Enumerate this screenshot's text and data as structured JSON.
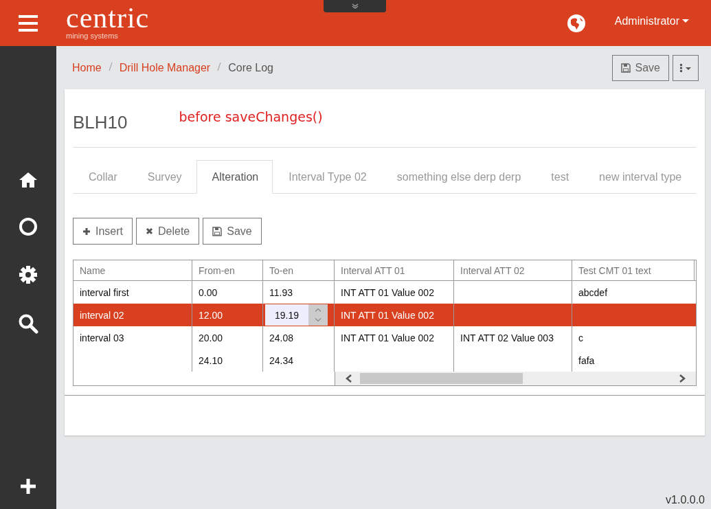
{
  "header": {
    "logo": "centric",
    "logo_tagline": "mining systems",
    "user": "Administrator"
  },
  "breadcrumb": [
    {
      "label": "Home",
      "link": true
    },
    {
      "label": "Drill Hole Manager",
      "link": true
    },
    {
      "label": "Core Log",
      "link": false
    }
  ],
  "page_actions": {
    "save": "Save"
  },
  "record": {
    "title": "BLH10",
    "note": "before saveChanges()"
  },
  "tabs": [
    {
      "label": "Collar",
      "selected": false
    },
    {
      "label": "Survey",
      "selected": false
    },
    {
      "label": "Alteration",
      "selected": true
    },
    {
      "label": "Interval Type 02",
      "selected": false
    },
    {
      "label": "something else derp derp",
      "selected": false
    },
    {
      "label": "test",
      "selected": false
    },
    {
      "label": "new interval type",
      "selected": false
    }
  ],
  "toolbar": [
    {
      "kind": "insert",
      "label": "Insert"
    },
    {
      "kind": "delete",
      "label": "Delete"
    },
    {
      "kind": "save",
      "label": "Save"
    }
  ],
  "table": {
    "columns": [
      "Name",
      "From-en",
      "To-en",
      "Interval ATT 01",
      "Interval ATT 02",
      "Test CMT 01 text"
    ],
    "rows": [
      {
        "selected": false,
        "cells": [
          "interval first",
          "0.00",
          "11.93",
          "INT ATT 01 Value 002",
          null,
          "abcdef"
        ]
      },
      {
        "selected": true,
        "cells": [
          "interval 02",
          "12.00",
          {
            "kind": "spinner",
            "value": "19.19"
          },
          "INT ATT 01 Value 002",
          null,
          null
        ]
      },
      {
        "selected": false,
        "cells": [
          "interval 03",
          "20.00",
          "24.08",
          "INT ATT 01 Value 002",
          "INT ATT 02 Value 003",
          "c"
        ]
      },
      {
        "selected": false,
        "cells": [
          null,
          "24.10",
          "24.34",
          null,
          null,
          "fafa"
        ]
      }
    ]
  },
  "version": "v1.0.0.0"
}
